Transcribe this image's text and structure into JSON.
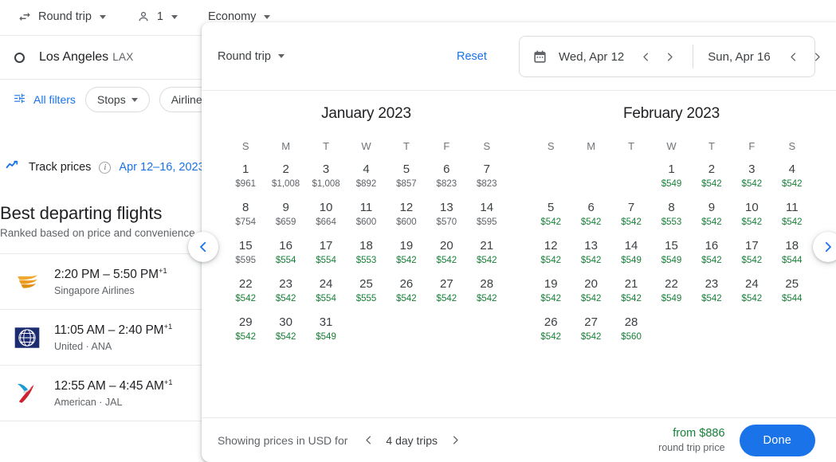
{
  "background": {
    "topbar": {
      "trip_type": "Round trip",
      "passengers": "1",
      "cabin": "Economy"
    },
    "origin": {
      "city": "Los Angeles",
      "code": "LAX"
    },
    "filters": {
      "all_filters": "All filters",
      "chips": [
        "Stops",
        "Airlines"
      ]
    },
    "track": {
      "label": "Track prices",
      "dates": "Apr 12–16, 2023"
    },
    "best": {
      "title": "Best departing flights",
      "subtitle": "Ranked based on price and convenience"
    },
    "flights": [
      {
        "times": "2:20 PM – 5:50 PM",
        "plus": "+1",
        "airline": "Singapore Airlines",
        "logo": "singapore-airlines-logo"
      },
      {
        "times": "11:05 AM – 2:40 PM",
        "plus": "+1",
        "airline": "United · ANA",
        "logo": "united-airlines-logo"
      },
      {
        "times": "12:55 AM – 4:45 AM",
        "plus": "+1",
        "airline": "American · JAL",
        "logo": "american-airlines-logo"
      }
    ]
  },
  "nav": {
    "prev_icon": "chevron-left-icon",
    "next_icon": "chevron-right-icon"
  },
  "panel": {
    "trip_type": "Round trip",
    "reset_label": "Reset",
    "departure": {
      "label": "Wed, Apr 12",
      "prev_icon": "chevron-left-icon",
      "next_icon": "chevron-right-icon"
    },
    "return": {
      "label": "Sun, Apr 16",
      "prev_icon": "chevron-left-icon",
      "next_icon": "chevron-right-icon"
    },
    "calendar_icon": "calendar-icon",
    "weekdays": [
      "S",
      "M",
      "T",
      "W",
      "T",
      "F",
      "S"
    ],
    "months": [
      {
        "title": "January 2023",
        "lead_blanks": 0,
        "days": [
          {
            "day": "1",
            "price": "$961",
            "low": false
          },
          {
            "day": "2",
            "price": "$1,008",
            "low": false
          },
          {
            "day": "3",
            "price": "$1,008",
            "low": false
          },
          {
            "day": "4",
            "price": "$892",
            "low": false
          },
          {
            "day": "5",
            "price": "$857",
            "low": false
          },
          {
            "day": "6",
            "price": "$823",
            "low": false
          },
          {
            "day": "7",
            "price": "$823",
            "low": false
          },
          {
            "day": "8",
            "price": "$754",
            "low": false
          },
          {
            "day": "9",
            "price": "$659",
            "low": false
          },
          {
            "day": "10",
            "price": "$664",
            "low": false
          },
          {
            "day": "11",
            "price": "$600",
            "low": false
          },
          {
            "day": "12",
            "price": "$600",
            "low": false
          },
          {
            "day": "13",
            "price": "$570",
            "low": false
          },
          {
            "day": "14",
            "price": "$595",
            "low": false
          },
          {
            "day": "15",
            "price": "$595",
            "low": false
          },
          {
            "day": "16",
            "price": "$554",
            "low": true
          },
          {
            "day": "17",
            "price": "$554",
            "low": true
          },
          {
            "day": "18",
            "price": "$553",
            "low": true
          },
          {
            "day": "19",
            "price": "$542",
            "low": true
          },
          {
            "day": "20",
            "price": "$542",
            "low": true
          },
          {
            "day": "21",
            "price": "$542",
            "low": true
          },
          {
            "day": "22",
            "price": "$542",
            "low": true
          },
          {
            "day": "23",
            "price": "$542",
            "low": true
          },
          {
            "day": "24",
            "price": "$554",
            "low": true
          },
          {
            "day": "25",
            "price": "$555",
            "low": true
          },
          {
            "day": "26",
            "price": "$542",
            "low": true
          },
          {
            "day": "27",
            "price": "$542",
            "low": true
          },
          {
            "day": "28",
            "price": "$542",
            "low": true
          },
          {
            "day": "29",
            "price": "$542",
            "low": true
          },
          {
            "day": "30",
            "price": "$542",
            "low": true
          },
          {
            "day": "31",
            "price": "$549",
            "low": true
          }
        ]
      },
      {
        "title": "February 2023",
        "lead_blanks": 3,
        "days": [
          {
            "day": "1",
            "price": "$549",
            "low": true
          },
          {
            "day": "2",
            "price": "$542",
            "low": true
          },
          {
            "day": "3",
            "price": "$542",
            "low": true
          },
          {
            "day": "4",
            "price": "$542",
            "low": true
          },
          {
            "day": "5",
            "price": "$542",
            "low": true
          },
          {
            "day": "6",
            "price": "$542",
            "low": true
          },
          {
            "day": "7",
            "price": "$542",
            "low": true
          },
          {
            "day": "8",
            "price": "$553",
            "low": true
          },
          {
            "day": "9",
            "price": "$542",
            "low": true
          },
          {
            "day": "10",
            "price": "$542",
            "low": true
          },
          {
            "day": "11",
            "price": "$542",
            "low": true
          },
          {
            "day": "12",
            "price": "$542",
            "low": true
          },
          {
            "day": "13",
            "price": "$542",
            "low": true
          },
          {
            "day": "14",
            "price": "$549",
            "low": true
          },
          {
            "day": "15",
            "price": "$549",
            "low": true
          },
          {
            "day": "16",
            "price": "$542",
            "low": true
          },
          {
            "day": "17",
            "price": "$542",
            "low": true
          },
          {
            "day": "18",
            "price": "$544",
            "low": true
          },
          {
            "day": "19",
            "price": "$542",
            "low": true
          },
          {
            "day": "20",
            "price": "$542",
            "low": true
          },
          {
            "day": "21",
            "price": "$542",
            "low": true
          },
          {
            "day": "22",
            "price": "$549",
            "low": true
          },
          {
            "day": "23",
            "price": "$542",
            "low": true
          },
          {
            "day": "24",
            "price": "$542",
            "low": true
          },
          {
            "day": "25",
            "price": "$544",
            "low": true
          },
          {
            "day": "26",
            "price": "$542",
            "low": true
          },
          {
            "day": "27",
            "price": "$542",
            "low": true
          },
          {
            "day": "28",
            "price": "$560",
            "low": true
          }
        ]
      }
    ],
    "footer": {
      "showing_text": "Showing prices in USD for",
      "trip_length": "4 day trips",
      "prev_icon": "chevron-left-icon",
      "next_icon": "chevron-right-icon",
      "from_price": "from $886",
      "price_caption": "round trip price",
      "done_label": "Done"
    }
  },
  "colors": {
    "accent_blue": "#1a73e8",
    "low_price_green": "#188038",
    "text_primary": "#202124",
    "text_secondary": "#5f6368"
  }
}
